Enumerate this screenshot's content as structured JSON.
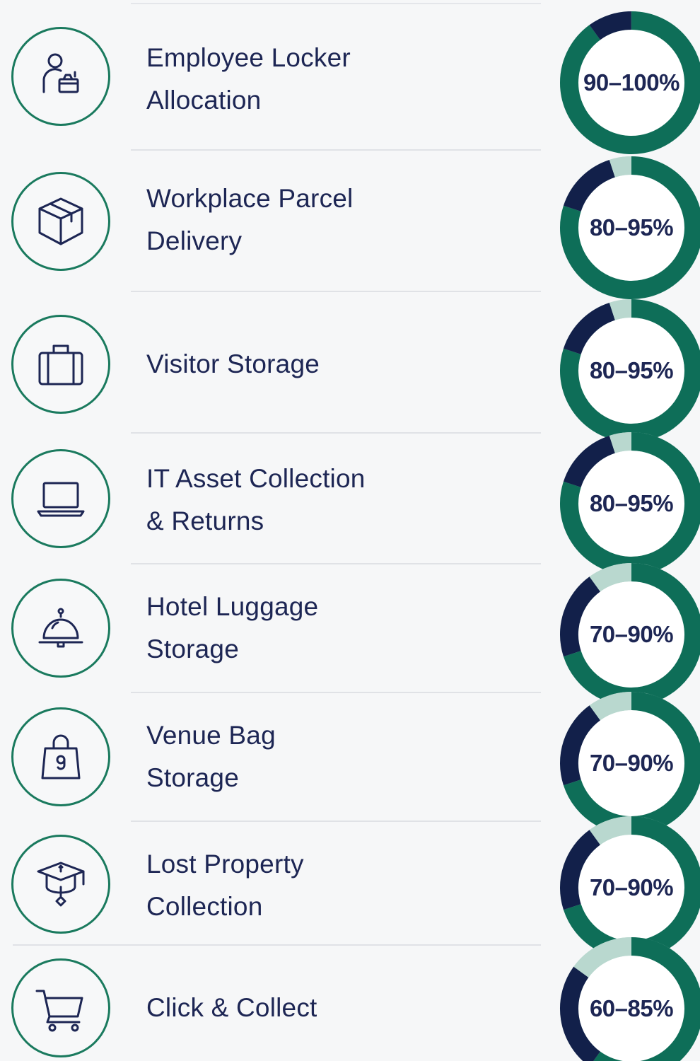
{
  "colors": {
    "text": "#1d2654",
    "icon_ring": "#1a7a5e",
    "donut_green": "#0e6e58",
    "donut_navy": "#12204a",
    "donut_light": "#b9d8cf",
    "divider": "#e0e2e6",
    "background": "#f6f7f8"
  },
  "items": [
    {
      "icon": "employee-locker-icon",
      "lines": [
        "Employee Locker",
        "Allocation"
      ],
      "range": "90–100%",
      "min": 90,
      "max": 100
    },
    {
      "icon": "parcel-box-icon",
      "lines": [
        "Workplace Parcel",
        "Delivery"
      ],
      "range": "80–95%",
      "min": 80,
      "max": 95
    },
    {
      "icon": "suitcase-icon",
      "lines": [
        "Visitor Storage"
      ],
      "range": "80–95%",
      "min": 80,
      "max": 95
    },
    {
      "icon": "laptop-icon",
      "lines": [
        "IT Asset Collection",
        "& Returns"
      ],
      "range": "80–95%",
      "min": 80,
      "max": 95
    },
    {
      "icon": "service-bell-icon",
      "lines": [
        "Hotel Luggage",
        "Storage"
      ],
      "range": "70–90%",
      "min": 70,
      "max": 90
    },
    {
      "icon": "shopping-bag-icon",
      "lines": [
        "Venue Bag",
        "Storage"
      ],
      "range": "70–90%",
      "min": 70,
      "max": 90
    },
    {
      "icon": "lost-property-icon",
      "lines": [
        "Lost Property",
        "Collection"
      ],
      "range": "70–90%",
      "min": 70,
      "max": 90
    },
    {
      "icon": "shopping-cart-icon",
      "lines": [
        "Click & Collect"
      ],
      "range": "60–85%",
      "min": 60,
      "max": 85
    }
  ]
}
